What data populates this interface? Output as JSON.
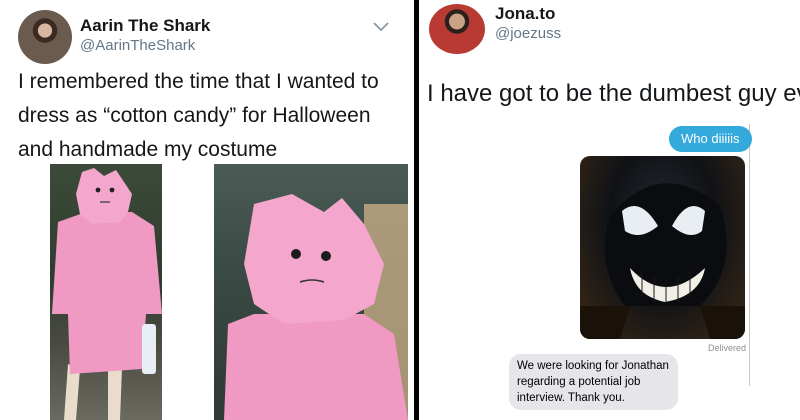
{
  "left_tweet": {
    "name": "Aarin The Shark",
    "handle": "@AarinTheShark",
    "lines": [
      "I remembered the time that I wanted to",
      "dress as “cotton candy” for Halloween",
      "and handmade my costume"
    ],
    "icons": {
      "menu": "chevron-down-icon"
    }
  },
  "right_tweet": {
    "name": "Jona.to",
    "handle": "@joezuss",
    "text": "I have got to be the dumbest guy ever",
    "chat": {
      "sent_message": "Who diiiiis",
      "delivered_label": "Delivered",
      "received_lines": [
        "We were looking for Jonathan",
        "regarding a potential job",
        "interview. Thank you."
      ]
    }
  },
  "colors": {
    "imessage_blue": "#34aadc",
    "received_gray": "#e5e5ea",
    "costume_pink": "#f09ac3",
    "handle_gray": "#657786"
  }
}
